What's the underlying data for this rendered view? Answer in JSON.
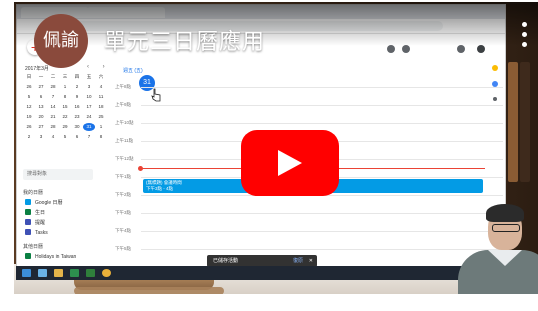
{
  "video": {
    "channel_avatar_text": "佩諭",
    "title": "單元三日曆應用",
    "play_icon": "play-triangle-icon",
    "menu_icon": "more-vert-icon"
  },
  "browser": {
    "tabs": [
      "",
      ""
    ],
    "address": ""
  },
  "calendar": {
    "mini_month_title": "2017年3月",
    "mini_nav": "‹ ›",
    "weekday_headers": [
      "日",
      "一",
      "二",
      "三",
      "四",
      "五",
      "六"
    ],
    "mini_days": [
      "26",
      "27",
      "28",
      "1",
      "2",
      "3",
      "4",
      "5",
      "6",
      "7",
      "8",
      "9",
      "10",
      "11",
      "12",
      "13",
      "14",
      "15",
      "16",
      "17",
      "18",
      "19",
      "20",
      "21",
      "22",
      "23",
      "24",
      "25",
      "26",
      "27",
      "28",
      "29",
      "30",
      "31",
      "1",
      "2",
      "3",
      "4",
      "5",
      "6",
      "7",
      "8"
    ],
    "today_index": 33,
    "search_people_placeholder": "搜尋對象",
    "my_calendars_title": "我的日曆",
    "my_calendars": [
      {
        "name": "Google 日曆",
        "color": "#039be5"
      },
      {
        "name": "生日",
        "color": "#0b8043"
      },
      {
        "name": "提醒",
        "color": "#3f51b5"
      },
      {
        "name": "Tasks",
        "color": "#3f51b5"
      }
    ],
    "other_calendars_title": "其他日曆",
    "other_calendars": [
      {
        "name": "Holidays in Taiwan",
        "color": "#0b8043"
      }
    ],
    "day_label": "週五 (五)",
    "day_number": "31",
    "hour_labels": [
      "上午8點",
      "上午9點",
      "上午10點",
      "上午11點",
      "下午12點",
      "下午1點",
      "下午2點",
      "下午3點",
      "下午4點",
      "下午5點"
    ],
    "event_title": "(無標題) 會議時間",
    "event_time": "下午3點 - 4點",
    "toast_text": "已儲存活動",
    "toast_action": "復原",
    "toast_close": "✕"
  },
  "colors": {
    "accent": "#1a73e8",
    "event": "#039be5",
    "now_line": "#ea4335",
    "play_button": "#ff0000",
    "avatar_bg": "#8a4a3c"
  }
}
